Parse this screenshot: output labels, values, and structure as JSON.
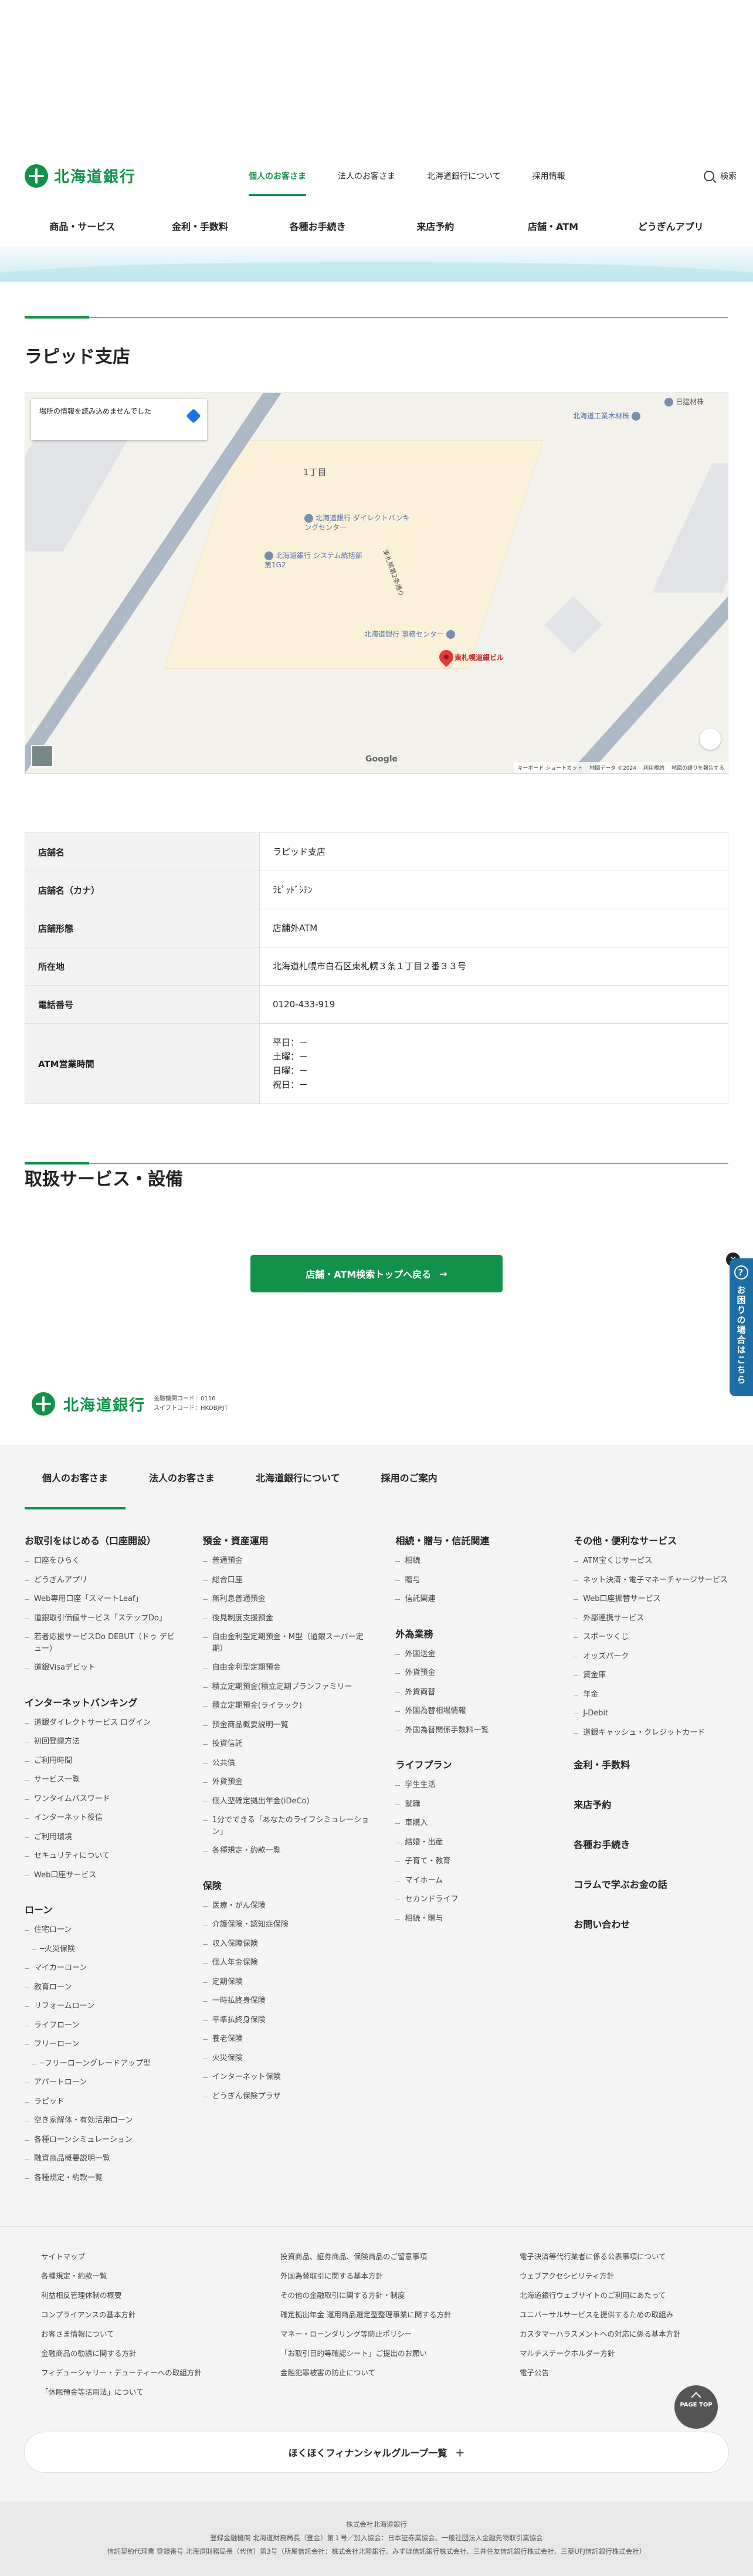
{
  "header": {
    "logo": "北海道銀行",
    "nav": [
      "個人のお客さま",
      "法人のお客さま",
      "北海道銀行について",
      "採用情報"
    ],
    "search": "検索",
    "subnav": [
      "商品・サービス",
      "金利・手数料",
      "各種お手続き",
      "来店予約",
      "店舗・ATM",
      "どうぎんアプリ"
    ]
  },
  "page": {
    "title": "ラピッド支店"
  },
  "map": {
    "info": "場所の情報を読み込めませんでした",
    "labels": {
      "choume": "1丁目",
      "direct": "北海道銀行 ダイレクトバンキングセンター",
      "system": "北海道銀行 システム統括部第1G2",
      "jimu": "北海道銀行 事務センター",
      "bldg": "東札幌道銀ビル",
      "machine": "北海道工業木材株",
      "road": "東札幌第2条通り",
      "topright": "日建材株"
    },
    "footer": [
      "キーボード ショートカット",
      "地図データ ©2024",
      "利用規約",
      "地図の誤りを報告する"
    ],
    "google": "Google"
  },
  "info_table": [
    {
      "label": "店舗名",
      "value": "ラピッド支店"
    },
    {
      "label": "店舗名（カナ）",
      "value": "ﾗﾋﾟｯﾄﾞｼﾃﾝ"
    },
    {
      "label": "店舗形態",
      "value": "店舗外ATM"
    },
    {
      "label": "所在地",
      "value": "北海道札幌市白石区東札幌３条１丁目２番３３号"
    },
    {
      "label": "電話番号",
      "value": "0120-433-919"
    },
    {
      "label": "ATM営業時間",
      "value": "平日：－\n土曜：－\n日曜：－\n祝日：－"
    }
  ],
  "services": {
    "title": "取扱サービス・設備"
  },
  "back_button": "店舗・ATM検索トップへ戻る",
  "side_help": {
    "label": "お困りの場合はこちら",
    "q": "?",
    "close": "×"
  },
  "footer": {
    "logo": "北海道銀行",
    "codes": [
      "金融機関コード：0116",
      "スイフトコード：HKDBJPJT"
    ],
    "tabs": [
      "個人のお客さま",
      "法人のお客さま",
      "北海道銀行について",
      "採用のご案内"
    ],
    "col1": {
      "h1": "お取引をはじめる（口座開設）",
      "l1": [
        "口座をひらく",
        "どうぎんアプリ",
        "Web専用口座「スマートLeaf」",
        "道銀取引価値サービス「ステップDo」",
        "若者応援サービスDo DEBUT（ドゥ デビュー）",
        "道銀Visaデビット"
      ],
      "h2": "インターネットバンキング",
      "l2": [
        "道銀ダイレクトサービス ログイン",
        "初回登録方法",
        "ご利用時間",
        "サービス一覧",
        "ワンタイムパスワード",
        "インターネット役信",
        "ご利用環境",
        "セキュリティについて",
        "Web口座サービス"
      ],
      "h3": "ローン",
      "l3": [
        "住宅ローン",
        "─火災保険",
        "マイカーローン",
        "教育ローン",
        "リフォームローン",
        "ライフローン",
        "フリーローン",
        "─フリーローングレードアップ型",
        "アパートローン",
        "ラピッド",
        "空き家解体・有効活用ローン",
        "各種ローンシミュレーション",
        "融資商品概要説明一覧",
        "各種規定・約款一覧"
      ]
    },
    "col2": {
      "h1": "預金・資産運用",
      "l1": [
        "普通預金",
        "総合口座",
        "無利息普通預金",
        "後見制度支援預金",
        "自由金利型定期預金・M型（道銀スーパー定期）",
        "自由金利型定期預金",
        "積立定期預金(積立定期プランファミリー",
        "積立定期預金(ライラック)",
        "預金商品概要説明一覧",
        "投資信託",
        "公共債",
        "外貨預金",
        "個人型確定拠出年金(iDeCo)",
        "1分でできる「あなたのライフシミュレーション」",
        "各種規定・約款一覧"
      ],
      "h2": "保険",
      "l2": [
        "医療・がん保険",
        "介護保険・認知症保険",
        "収入保障保険",
        "個人年金保険",
        "定期保険",
        "一時払終身保険",
        "平準払終身保険",
        "養老保険",
        "火災保険",
        "インターネット保険",
        "どうぎん保険プラザ"
      ]
    },
    "col3": {
      "h1": "相続・贈与・信託関連",
      "l1": [
        "相続",
        "贈与",
        "信託関連"
      ],
      "h2": "外為業務",
      "l2": [
        "外国送金",
        "外貨預金",
        "外貨両替",
        "外国為替相場情報",
        "外国為替関係手数料一覧"
      ],
      "h3": "ライフプラン",
      "l3": [
        "学生生活",
        "就職",
        "車購入",
        "結婚・出産",
        "子育て・教育",
        "マイホーム",
        "セカンドライフ",
        "相続・贈与"
      ]
    },
    "col4": {
      "h1": "その他・便利なサービス",
      "l1": [
        "ATM宝くじサービス",
        "ネット決済・電子マネーチャージサービス",
        "Web口座振替サービス",
        "外部連携サービス",
        "スポーツくじ",
        "オッズパーク",
        "貸金庫",
        "年金",
        "J-Debit",
        "道銀キャッシュ・クレジットカード"
      ],
      "plain": [
        "金利・手数料",
        "来店予約",
        "各種お手続き",
        "コラムで学ぶお金の話",
        "お問い合わせ"
      ]
    },
    "links": [
      "サイトマップ",
      "投資商品、証券商品、保険商品のご留意事項",
      "電子決済等代行業者に係る公表事項について",
      "各種規定・約款一覧",
      "外国為替取引に関する基本方針",
      "ウェブアクセシビリティ方針",
      "利益相反管理体制の概要",
      "その他の金融取引に関する方針・制度",
      "北海道銀行ウェブサイトのご利用にあたって",
      "コンプライアンスの基本方針",
      "確定拠出年金 運用商品選定型整理事業に関する方針",
      "ユニバーサルサービスを提供するための取組み",
      "お客さま情報について",
      "マネー・ローンダリング等防止ポリシー",
      "カスタマーハラスメントへの対応に係る基本方針",
      "金融商品の勧誘に関する方針",
      "「お取引目的等確認シート」ご提出のお願い",
      "マルチステークホルダー方針",
      "フィデューシャリー・デューティーへの取組方針",
      "金融犯罪被害の防止について",
      "電子公告",
      "「休眠預金等活用法」について"
    ],
    "group": "ほくほくフィナンシャルグループ一覧",
    "pagetop": "PAGE TOP",
    "copy": [
      "株式会社北海道銀行",
      "登録金融機関 北海道財務局長（登金）第１号／加入協会：日本証券業協会、一般社団法人金融先物取引業協会",
      "信託契約代理業 登録番号 北海道財務局長（代信）第3号（所属信託会社：株式会社北陸銀行、みずほ信託銀行株式会社、三井住友信託銀行株式会社、三菱UFJ信託銀行株式会社）"
    ]
  }
}
